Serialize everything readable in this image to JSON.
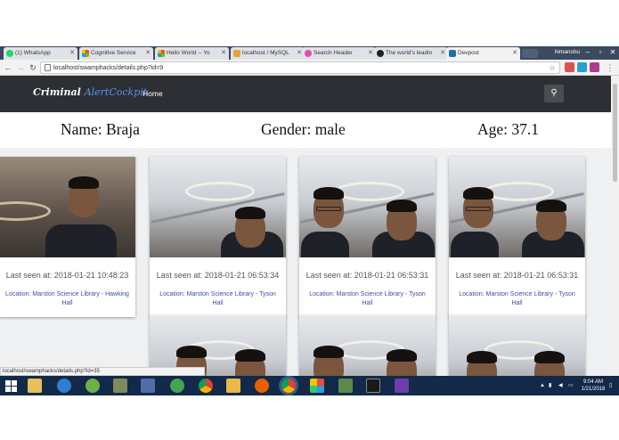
{
  "browser": {
    "tabs": [
      {
        "title": "(1) WhatsApp",
        "color": "#25d366"
      },
      {
        "title": "Cognitive Service",
        "color": "#f25022"
      },
      {
        "title": "Hello World -- Yo",
        "color": "#f25022"
      },
      {
        "title": "localhost / MySQL",
        "color": "#e8a13b"
      },
      {
        "title": "Search Header",
        "color": "#e44db0"
      },
      {
        "title": "The world's leadin",
        "color": "#222222"
      },
      {
        "title": "Devpost",
        "color": "#1d6fa5"
      }
    ],
    "profile_name": "himanshu",
    "url": "localhost/swamphacks/details.php?id=9"
  },
  "site": {
    "brand_main": "Criminal ",
    "brand_accent": "AlertCockpit",
    "nav_home": "Home",
    "search_icon": "search-icon"
  },
  "profile": {
    "name": "Name: Braja",
    "gender": "Gender: male",
    "age": "Age: 37.1"
  },
  "sightings": [
    {
      "seen": "Last seen at: 2018-01-21 10:48:23",
      "location": "Location: Marston Science Library - Hawking Hall"
    },
    {
      "seen": "Last seen at: 2018-01-21 06:53:34",
      "location": "Location: Marston Science Library - Tyson Hall"
    },
    {
      "seen": "Last seen at: 2018-01-21 06:53:31",
      "location": "Location: Marston Science Library - Tyson Hall"
    },
    {
      "seen": "Last seen at: 2018-01-21 06:53:31",
      "location": "Location: Marston Science Library - Tyson Hall"
    }
  ],
  "status_url": "localhost/swamphacks/details.php?id=35",
  "taskbar": {
    "time": "9:04 AM",
    "date": "1/21/2018"
  },
  "colors": {
    "navbar": "#2c2f33",
    "brand_accent": "#5b8ff0",
    "link": "#3a4fb0",
    "taskbar": "#13294a"
  }
}
